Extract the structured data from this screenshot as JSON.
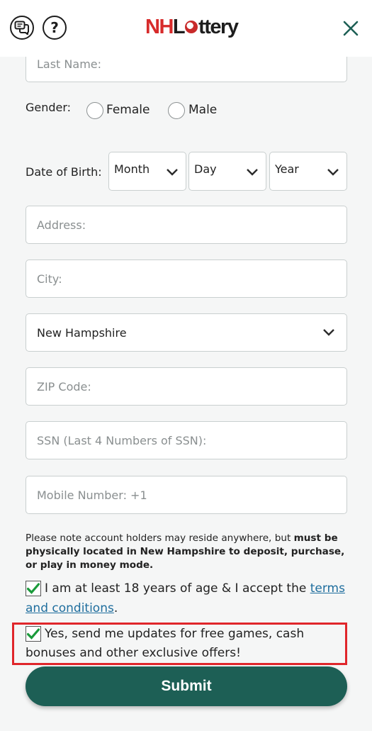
{
  "header": {
    "logo_nh": "NH",
    "logo_rest_a": "L",
    "logo_rest_b": "ttery"
  },
  "form": {
    "last_name_placeholder": "Last Name:",
    "gender_label": "Gender:",
    "gender_female": "Female",
    "gender_male": "Male",
    "dob_label": "Date of Birth:",
    "dob_month": "Month",
    "dob_day": "Day",
    "dob_year": "Year",
    "address_placeholder": "Address:",
    "city_placeholder": "City:",
    "state_value": "New Hampshire",
    "zip_placeholder": "ZIP Code:",
    "ssn_placeholder": "SSN (Last 4 Numbers of SSN):",
    "mobile_placeholder": "Mobile Number: +1"
  },
  "note": {
    "text_plain": "Please note account holders may reside anywhere, but ",
    "text_bold": "must be physically located in New Hampshire to deposit, purchase, or play in money mode."
  },
  "consent": {
    "age_text": "I am at least 18 years of age & I accept the ",
    "terms_link_a": "terms",
    "terms_link_b": "and conditions",
    "age_text_end": ".",
    "age_checked": true,
    "updates_text_a": "Yes, send me updates for free games, cash",
    "updates_text_b": "bonuses and other exclusive offers!",
    "updates_checked": true
  },
  "submit_label": "Submit",
  "colors": {
    "accent": "#1d5f55",
    "check": "#1a9a3a",
    "highlight": "#e0262b",
    "link": "#1f6e9e"
  }
}
